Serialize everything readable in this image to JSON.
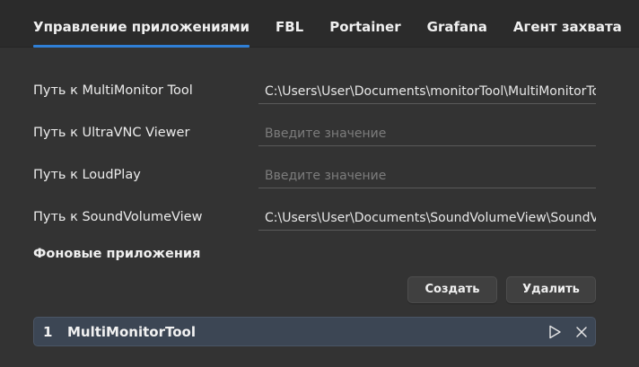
{
  "tabs": [
    {
      "label": "Управление приложениями",
      "active": true
    },
    {
      "label": "FBL",
      "active": false
    },
    {
      "label": "Portainer",
      "active": false
    },
    {
      "label": "Grafana",
      "active": false
    },
    {
      "label": "Агент захвата",
      "active": false
    }
  ],
  "fields": [
    {
      "label": "Путь к MultiMonitor Tool",
      "value": "C:\\Users\\User\\Documents\\monitorTool\\MultiMonitorTool.exe",
      "placeholder": "Введите значение"
    },
    {
      "label": "Путь к UltraVNC Viewer",
      "value": "",
      "placeholder": "Введите значение"
    },
    {
      "label": "Путь к LoudPlay",
      "value": "",
      "placeholder": "Введите значение"
    },
    {
      "label": "Путь к SoundVolumeView",
      "value": "C:\\Users\\User\\Documents\\SoundVolumeView\\SoundVolumeView.exe",
      "placeholder": "Введите значение"
    }
  ],
  "background_apps": {
    "title": "Фоновые приложения",
    "create_label": "Создать",
    "delete_label": "Удалить",
    "items": [
      {
        "index": "1",
        "name": "MultiMonitorTool"
      }
    ]
  },
  "icons": {
    "play": "play-icon",
    "close": "close-icon"
  },
  "colors": {
    "accent": "#2f7fd6",
    "background": "#333333",
    "tabbar": "#2b2b2b",
    "list_item": "#3c4654"
  }
}
